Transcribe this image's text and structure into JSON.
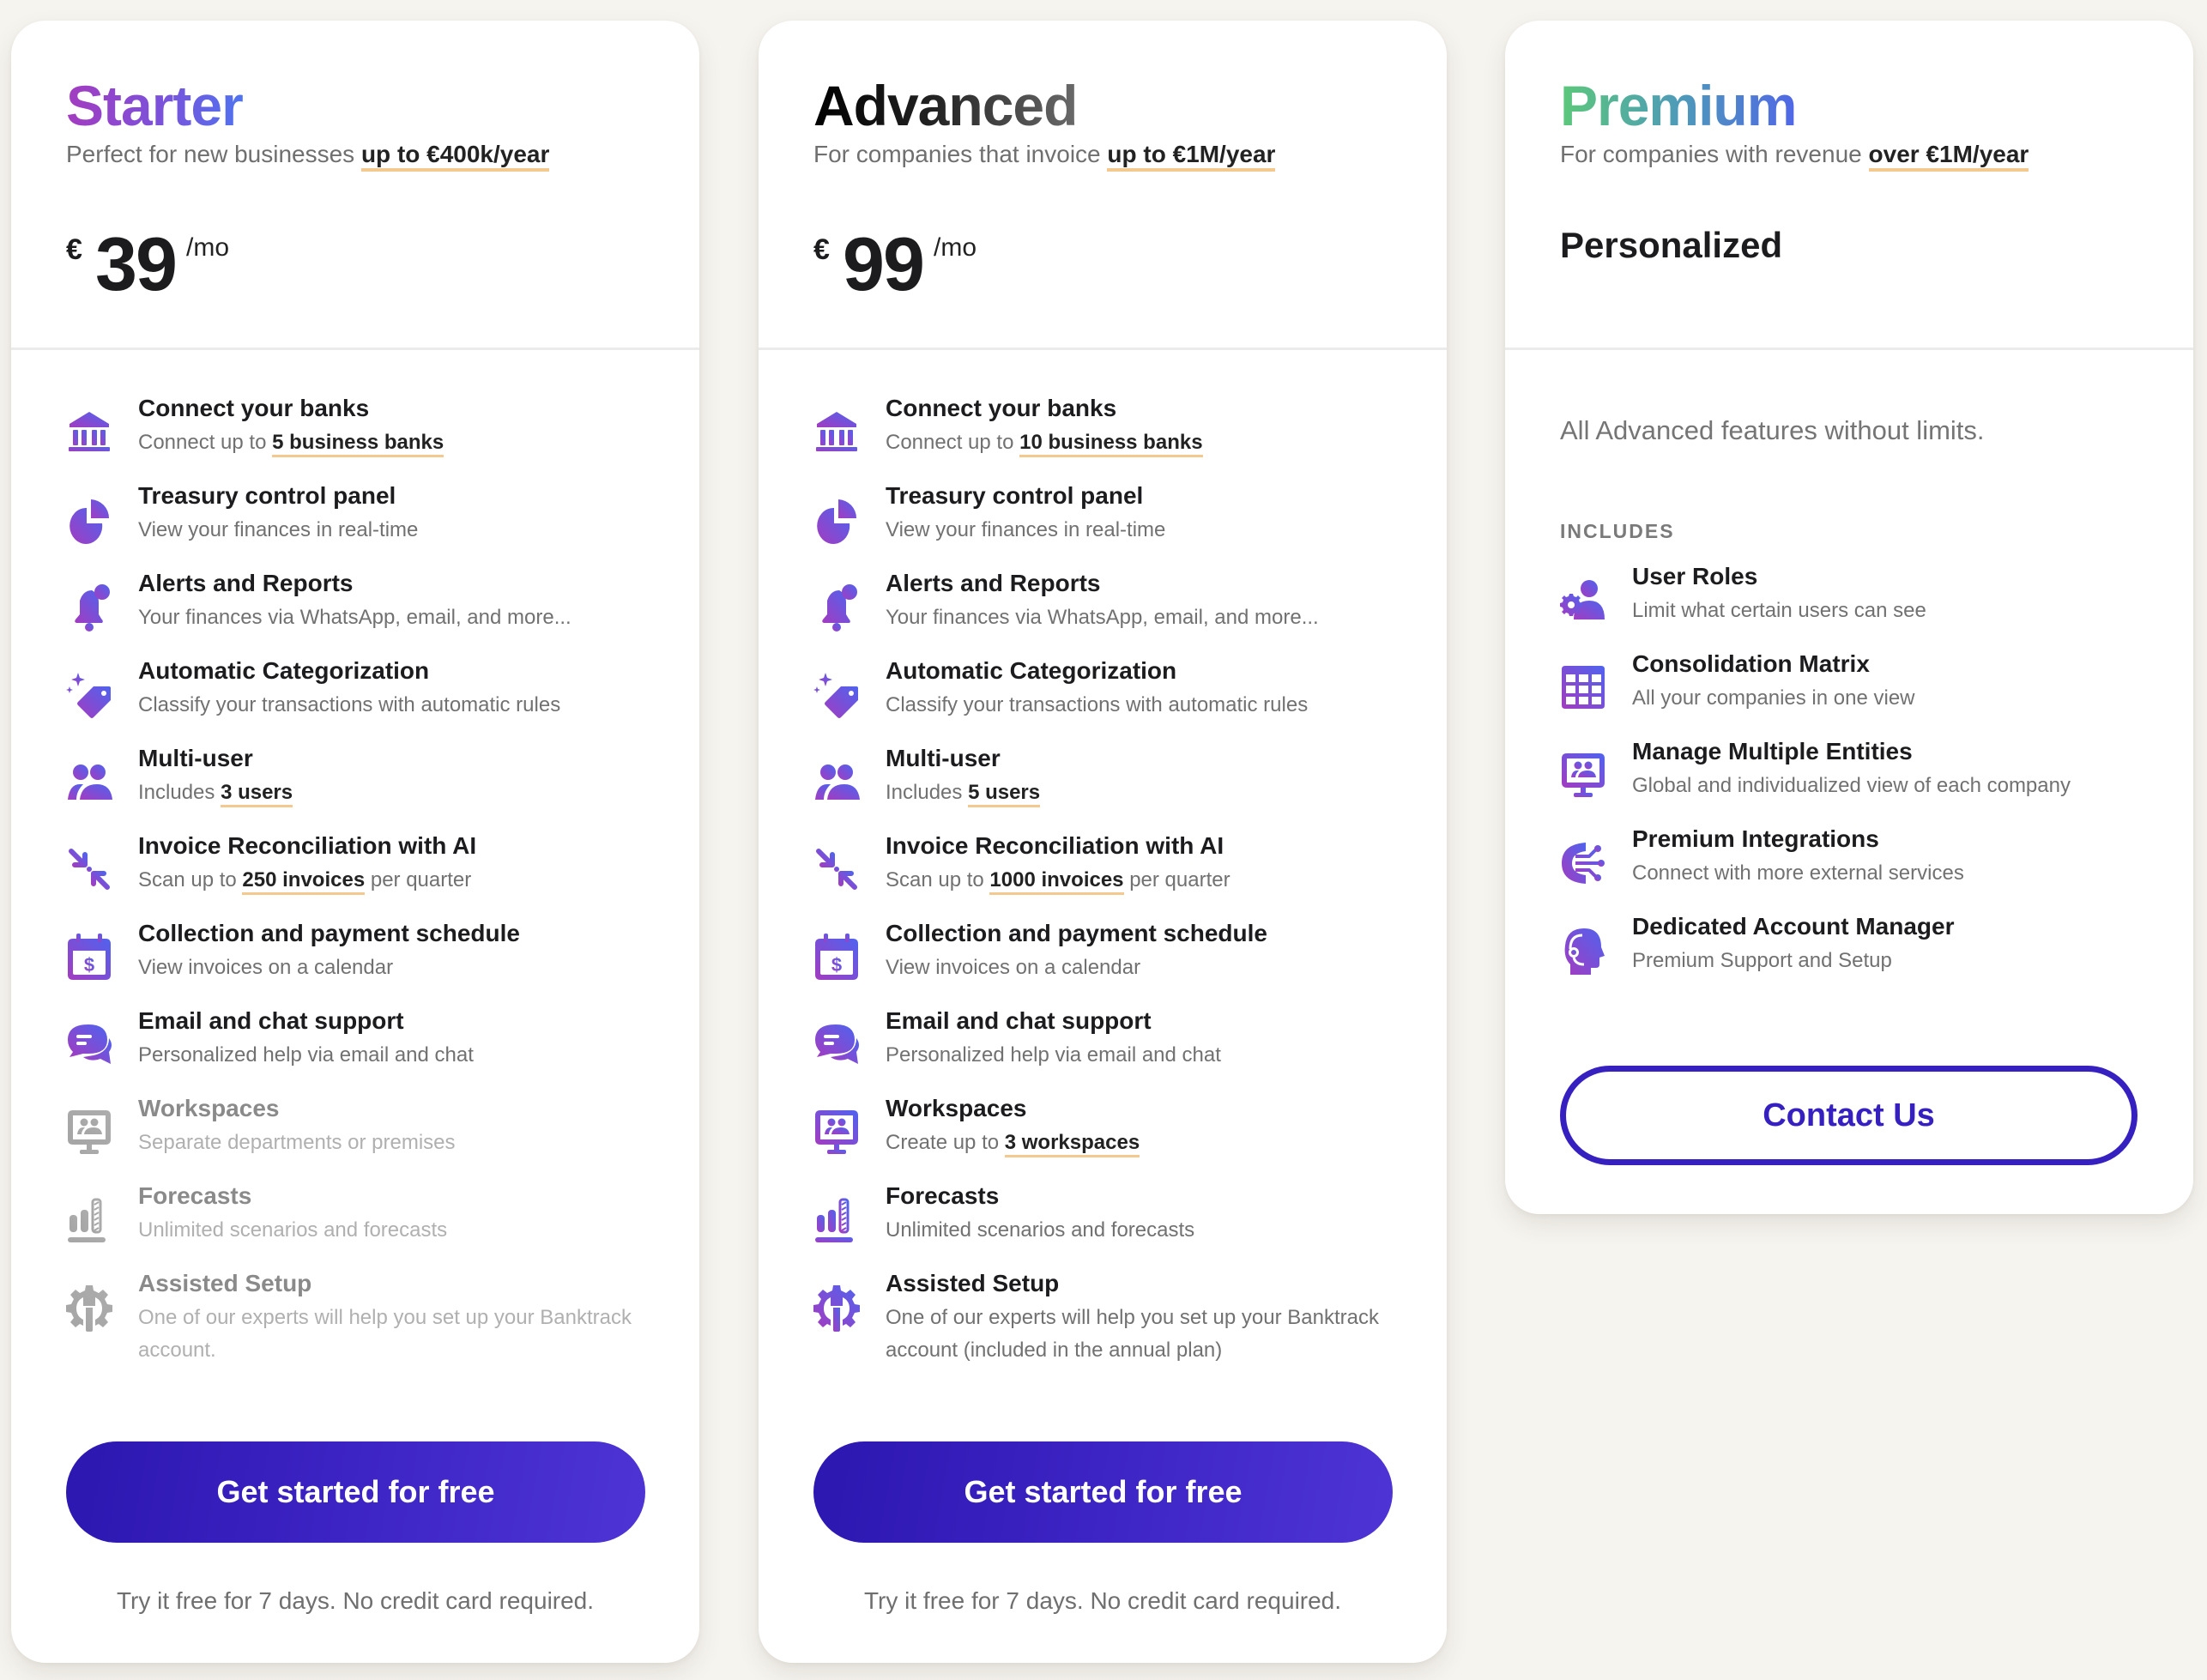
{
  "colors": {
    "page_bg": "#f6f4ef",
    "accent_button": "#3b22c2",
    "highlight_underline": "#f3c98f",
    "icon_gradient_start": "#a33cc0",
    "icon_gradient_end": "#4f63ef"
  },
  "plans": [
    {
      "id": "starter",
      "name": "Starter",
      "subtitle_prefix": "Perfect for new businesses ",
      "subtitle_highlight": "up to €400k/year",
      "currency": "€",
      "price": "39",
      "period": "/mo",
      "features": [
        {
          "icon": "bank-icon",
          "title": "Connect your banks",
          "desc_prefix": "Connect up to ",
          "desc_highlight": "5 business banks",
          "desc_suffix": "",
          "enabled": true
        },
        {
          "icon": "pie-chart-icon",
          "title": "Treasury control panel",
          "desc_prefix": "View your finances in real-time",
          "desc_highlight": "",
          "desc_suffix": "",
          "enabled": true
        },
        {
          "icon": "bell-icon",
          "title": "Alerts and Reports",
          "desc_prefix": "Your finances via WhatsApp, email, and more...",
          "desc_highlight": "",
          "desc_suffix": "",
          "enabled": true
        },
        {
          "icon": "tag-sparkle-icon",
          "title": "Automatic Categorization",
          "desc_prefix": "Classify your transactions with automatic rules",
          "desc_highlight": "",
          "desc_suffix": "",
          "enabled": true
        },
        {
          "icon": "users-icon",
          "title": "Multi-user",
          "desc_prefix": "Includes ",
          "desc_highlight": "3 users",
          "desc_suffix": "",
          "enabled": true
        },
        {
          "icon": "converge-arrows-icon",
          "title": "Invoice Reconciliation with AI",
          "desc_prefix": "Scan up to ",
          "desc_highlight": "250 invoices",
          "desc_suffix": " per quarter",
          "enabled": true
        },
        {
          "icon": "calendar-dollar-icon",
          "title": "Collection and payment schedule",
          "desc_prefix": "View invoices on a calendar",
          "desc_highlight": "",
          "desc_suffix": "",
          "enabled": true
        },
        {
          "icon": "chat-bubbles-icon",
          "title": "Email and chat support",
          "desc_prefix": "Personalized help via email and chat",
          "desc_highlight": "",
          "desc_suffix": "",
          "enabled": true
        },
        {
          "icon": "monitor-users-icon",
          "title": "Workspaces",
          "desc_prefix": "Separate departments or premises",
          "desc_highlight": "",
          "desc_suffix": "",
          "enabled": false
        },
        {
          "icon": "bar-chart-forecast-icon",
          "title": "Forecasts",
          "desc_prefix": "Unlimited scenarios and forecasts",
          "desc_highlight": "",
          "desc_suffix": "",
          "enabled": false
        },
        {
          "icon": "gear-wrench-icon",
          "title": "Assisted Setup",
          "desc_prefix": "One of our experts will help you set up your Banktrack account.",
          "desc_highlight": "",
          "desc_suffix": "",
          "enabled": false
        }
      ],
      "cta": "Get started for free",
      "trial_note": "Try it free for 7 days. No credit card required."
    },
    {
      "id": "advanced",
      "name": "Advanced",
      "subtitle_prefix": "For companies that invoice ",
      "subtitle_highlight": "up to €1M/year",
      "currency": "€",
      "price": "99",
      "period": "/mo",
      "features": [
        {
          "icon": "bank-icon",
          "title": "Connect your banks",
          "desc_prefix": "Connect up to ",
          "desc_highlight": "10 business banks",
          "desc_suffix": "",
          "enabled": true
        },
        {
          "icon": "pie-chart-icon",
          "title": "Treasury control panel",
          "desc_prefix": "View your finances in real-time",
          "desc_highlight": "",
          "desc_suffix": "",
          "enabled": true
        },
        {
          "icon": "bell-icon",
          "title": "Alerts and Reports",
          "desc_prefix": "Your finances via WhatsApp, email, and more...",
          "desc_highlight": "",
          "desc_suffix": "",
          "enabled": true
        },
        {
          "icon": "tag-sparkle-icon",
          "title": "Automatic Categorization",
          "desc_prefix": "Classify your transactions with automatic rules",
          "desc_highlight": "",
          "desc_suffix": "",
          "enabled": true
        },
        {
          "icon": "users-icon",
          "title": "Multi-user",
          "desc_prefix": "Includes ",
          "desc_highlight": "5 users",
          "desc_suffix": "",
          "enabled": true
        },
        {
          "icon": "converge-arrows-icon",
          "title": "Invoice Reconciliation with AI",
          "desc_prefix": "Scan up to ",
          "desc_highlight": "1000 invoices",
          "desc_suffix": " per quarter",
          "enabled": true
        },
        {
          "icon": "calendar-dollar-icon",
          "title": "Collection and payment schedule",
          "desc_prefix": "View invoices on a calendar",
          "desc_highlight": "",
          "desc_suffix": "",
          "enabled": true
        },
        {
          "icon": "chat-bubbles-icon",
          "title": "Email and chat support",
          "desc_prefix": "Personalized help via email and chat",
          "desc_highlight": "",
          "desc_suffix": "",
          "enabled": true
        },
        {
          "icon": "monitor-users-icon",
          "title": "Workspaces",
          "desc_prefix": "Create up to ",
          "desc_highlight": "3 workspaces",
          "desc_suffix": "",
          "enabled": true
        },
        {
          "icon": "bar-chart-forecast-icon",
          "title": "Forecasts",
          "desc_prefix": "Unlimited scenarios and forecasts",
          "desc_highlight": "",
          "desc_suffix": "",
          "enabled": true
        },
        {
          "icon": "gear-wrench-icon",
          "title": "Assisted Setup",
          "desc_prefix": "One of our experts will help you set up your Banktrack account (included in the annual plan)",
          "desc_highlight": "",
          "desc_suffix": "",
          "enabled": true
        }
      ],
      "cta": "Get started for free",
      "trial_note": "Try it free for 7 days. No credit card required."
    },
    {
      "id": "premium",
      "name": "Premium",
      "subtitle_prefix": "For companies with revenue ",
      "subtitle_highlight": "over €1M/year",
      "price_label": "Personalized",
      "summary": "All Advanced features without limits.",
      "includes_label": "INCLUDES",
      "features": [
        {
          "icon": "user-gear-icon",
          "title": "User Roles",
          "desc_prefix": "Limit what certain users can see",
          "desc_highlight": "",
          "desc_suffix": "",
          "enabled": true
        },
        {
          "icon": "grid-table-icon",
          "title": "Consolidation Matrix",
          "desc_prefix": "All your companies in one view",
          "desc_highlight": "",
          "desc_suffix": "",
          "enabled": true
        },
        {
          "icon": "monitor-users-icon",
          "title": "Manage Multiple Entities",
          "desc_prefix": "Global and individualized view of each company",
          "desc_highlight": "",
          "desc_suffix": "",
          "enabled": true
        },
        {
          "icon": "integrations-icon",
          "title": "Premium Integrations",
          "desc_prefix": "Connect with more external services",
          "desc_highlight": "",
          "desc_suffix": "",
          "enabled": true
        },
        {
          "icon": "headset-head-icon",
          "title": "Dedicated Account Manager",
          "desc_prefix": "Premium Support and Setup",
          "desc_highlight": "",
          "desc_suffix": "",
          "enabled": true
        }
      ],
      "cta": "Contact Us"
    }
  ]
}
